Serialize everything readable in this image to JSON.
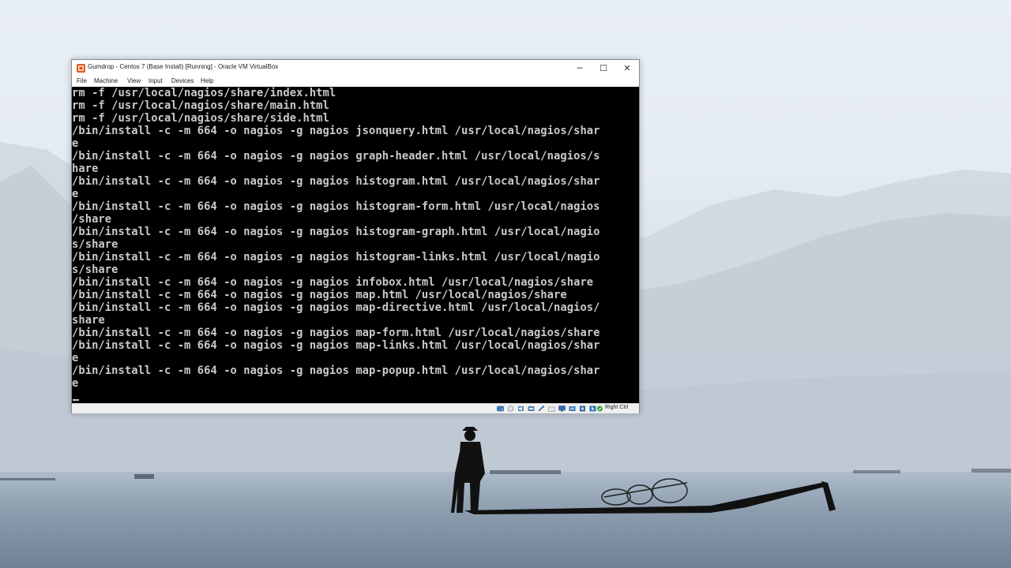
{
  "window": {
    "title": "Gumdrop - Centos 7 (Base Install) [Running] - Oracle VM VirtualBox",
    "minimize_glyph": "─",
    "maximize_glyph": "☐",
    "close_glyph": "✕"
  },
  "menubar": {
    "items": [
      "File",
      "Machine",
      "View",
      "Input",
      "Devices",
      "Help"
    ]
  },
  "console": {
    "lines": [
      "rm -f /usr/local/nagios/share/index.html",
      "rm -f /usr/local/nagios/share/main.html",
      "rm -f /usr/local/nagios/share/side.html",
      "/bin/install -c -m 664 -o nagios -g nagios jsonquery.html /usr/local/nagios/shar",
      "e",
      "/bin/install -c -m 664 -o nagios -g nagios graph-header.html /usr/local/nagios/s",
      "hare",
      "/bin/install -c -m 664 -o nagios -g nagios histogram.html /usr/local/nagios/shar",
      "e",
      "/bin/install -c -m 664 -o nagios -g nagios histogram-form.html /usr/local/nagios",
      "/share",
      "/bin/install -c -m 664 -o nagios -g nagios histogram-graph.html /usr/local/nagio",
      "s/share",
      "/bin/install -c -m 664 -o nagios -g nagios histogram-links.html /usr/local/nagio",
      "s/share",
      "/bin/install -c -m 664 -o nagios -g nagios infobox.html /usr/local/nagios/share",
      "/bin/install -c -m 664 -o nagios -g nagios map.html /usr/local/nagios/share",
      "/bin/install -c -m 664 -o nagios -g nagios map-directive.html /usr/local/nagios/",
      "share",
      "/bin/install -c -m 664 -o nagios -g nagios map-form.html /usr/local/nagios/share",
      "/bin/install -c -m 664 -o nagios -g nagios map-links.html /usr/local/nagios/shar",
      "e",
      "/bin/install -c -m 664 -o nagios -g nagios map-popup.html /usr/local/nagios/shar",
      "e"
    ]
  },
  "statusbar": {
    "icons": [
      "hard-disk-icon",
      "optical-drive-icon",
      "audio-icon",
      "network-icon",
      "usb-icon",
      "shared-folders-icon",
      "display-icon",
      "video-capture-icon",
      "cpu-icon",
      "mouse-integration-icon",
      "keyboard-capture-icon"
    ],
    "host_key": "Right Ctrl"
  }
}
